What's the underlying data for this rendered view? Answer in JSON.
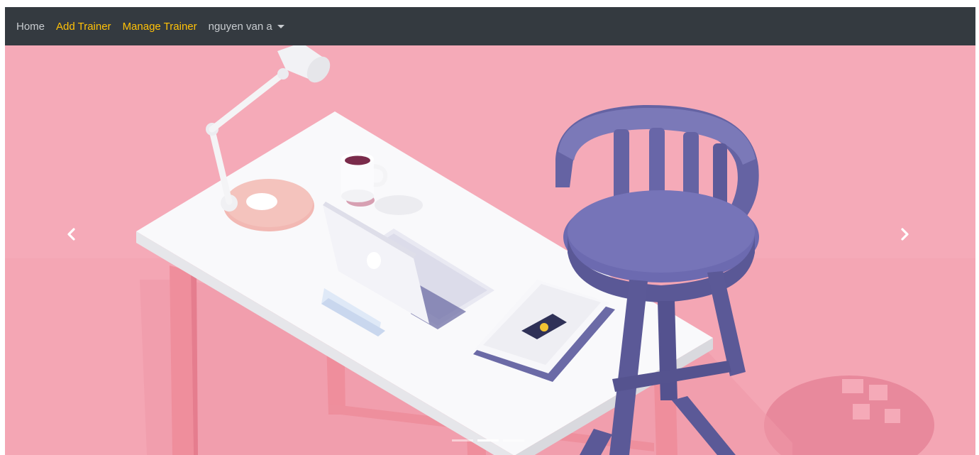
{
  "navbar": {
    "links": [
      {
        "label": "Home",
        "color": "#c8ccd0"
      },
      {
        "label": "Add Trainer",
        "color": "#ffc107"
      },
      {
        "label": "Manage Trainer",
        "color": "#ffc107"
      }
    ],
    "user": {
      "label": "nguyen van a",
      "icon": "caret-down-icon"
    },
    "background": "#343a40"
  },
  "carousel": {
    "background": "#f5a9b8",
    "controls": {
      "prev_icon": "chevron-left-icon",
      "next_icon": "chevron-right-icon"
    },
    "indicators": {
      "count": 3,
      "active": 1
    }
  }
}
